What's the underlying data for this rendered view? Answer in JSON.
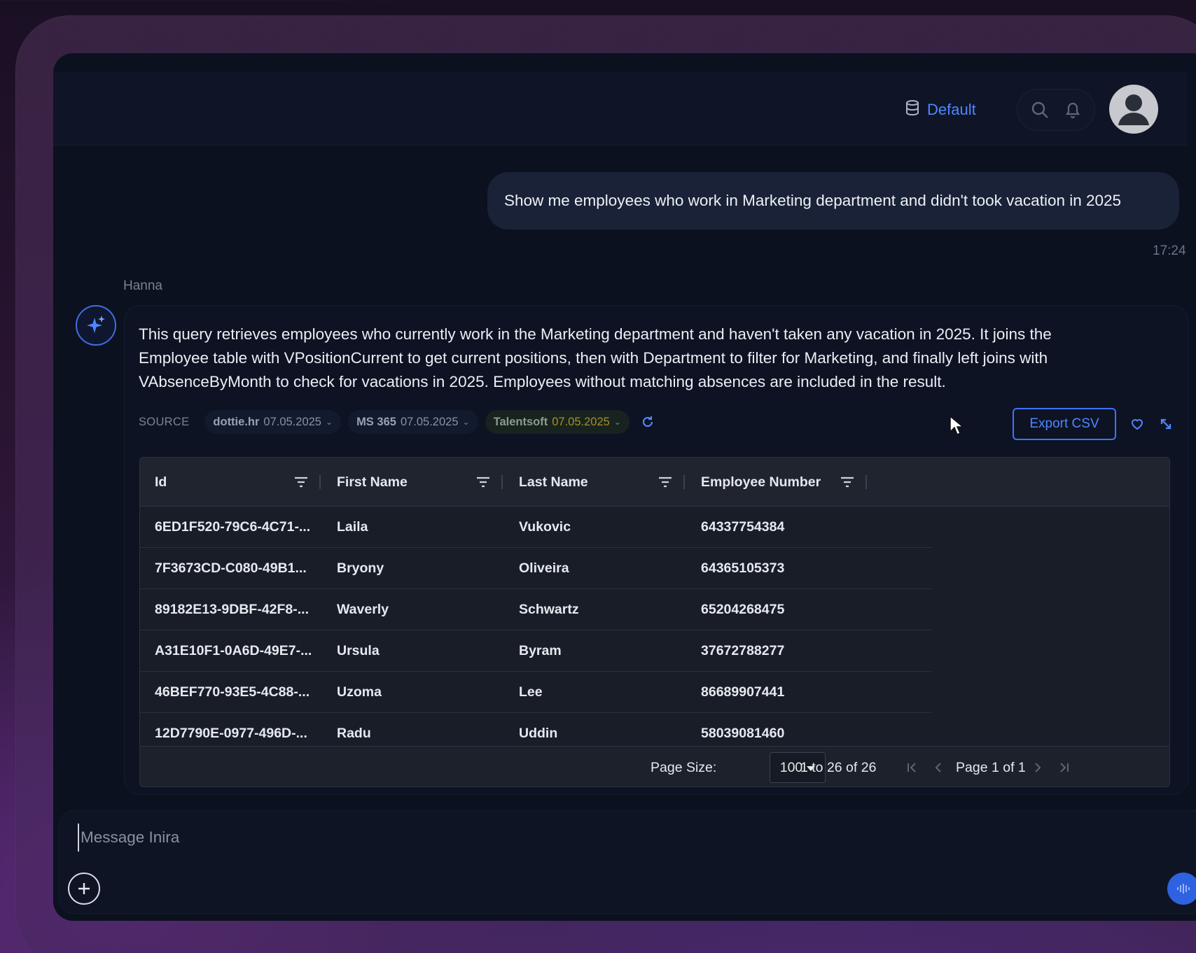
{
  "header": {
    "database_label": "Default",
    "icons": [
      "database-icon",
      "search-icon",
      "bell-icon",
      "user-avatar"
    ]
  },
  "conversation": {
    "user_message": "Show me employees who work in Marketing department and didn't took vacation in 2025",
    "user_message_time": "17:24",
    "assistant_name": "Hanna",
    "assistant_text": "This query retrieves employees who currently work in the Marketing department and haven't taken any vacation in 2025. It joins the Employee table with VPositionCurrent to get current positions, then with Department to filter for Marketing, and finally left joins with VAbsenceByMonth to check for vacations in 2025. Employees without matching absences are included in the result."
  },
  "sources": {
    "label": "SOURCE",
    "items": [
      {
        "name": "dottie.hr",
        "date": "07.05.2025"
      },
      {
        "name": "MS 365",
        "date": "07.05.2025"
      },
      {
        "name": "Talentsoft",
        "date": "07.05.2025"
      }
    ]
  },
  "actions": {
    "export_label": "Export CSV"
  },
  "table": {
    "columns": [
      "Id",
      "First Name",
      "Last Name",
      "Employee Number"
    ],
    "rows": [
      [
        "6ED1F520-79C6-4C71-...",
        "Laila",
        "Vukovic",
        "64337754384"
      ],
      [
        "7F3673CD-C080-49B1...",
        "Bryony",
        "Oliveira",
        "64365105373"
      ],
      [
        "89182E13-9DBF-42F8-...",
        "Waverly",
        "Schwartz",
        "65204268475"
      ],
      [
        "A31E10F1-0A6D-49E7-...",
        "Ursula",
        "Byram",
        "37672788277"
      ],
      [
        "46BEF770-93E5-4C88-...",
        "Uzoma",
        "Lee",
        "86689907441"
      ],
      [
        "12D7790E-0977-496D-...",
        "Radu",
        "Uddin",
        "58039081460"
      ]
    ]
  },
  "pagination": {
    "page_size_label": "Page Size:",
    "page_size_value": "100",
    "range_text": "1 to 26 of 26",
    "page_text": "Page 1 of 1"
  },
  "composer": {
    "placeholder": "Message Inira"
  },
  "colors": {
    "accent": "#4f86ff",
    "background": "#0c1120",
    "grid_background": "#181d27"
  }
}
